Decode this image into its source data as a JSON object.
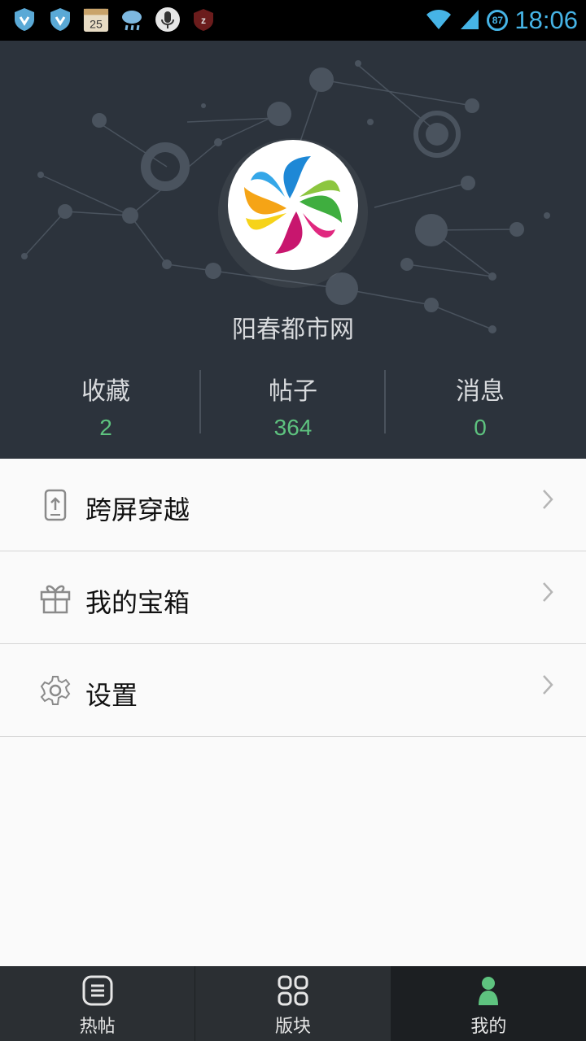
{
  "status_bar": {
    "time": "18:06",
    "battery": "87",
    "calendar_day": "25",
    "icons": [
      "shield-icon",
      "shield-icon",
      "calendar-icon",
      "cloud-rain-icon",
      "microphone-icon",
      "sleep-icon",
      "wifi-icon",
      "signal-icon",
      "battery-icon"
    ]
  },
  "profile": {
    "site_name": "阳春都市网",
    "stats": [
      {
        "label": "收藏",
        "value": "2"
      },
      {
        "label": "帖子",
        "value": "364"
      },
      {
        "label": "消息",
        "value": "0"
      }
    ]
  },
  "menu": [
    {
      "label": "跨屏穿越",
      "icon": "phone-upload-icon"
    },
    {
      "label": "我的宝箱",
      "icon": "gift-icon"
    },
    {
      "label": "设置",
      "icon": "gear-icon"
    }
  ],
  "bottom_nav": [
    {
      "label": "热帖",
      "icon": "list-icon"
    },
    {
      "label": "版块",
      "icon": "grid-icon"
    },
    {
      "label": "我的",
      "icon": "person-icon",
      "active": true
    }
  ],
  "colors": {
    "header_bg": "#2c333c",
    "accent_green": "#5ec37f",
    "clock_blue": "#46b4e6",
    "nav_bg": "#2b2f33"
  }
}
